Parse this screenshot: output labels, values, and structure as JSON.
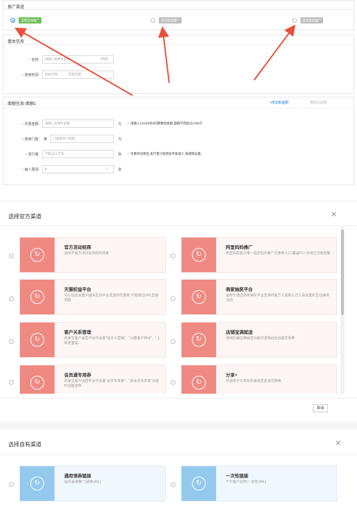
{
  "channel": {
    "section_title": "推广渠道",
    "options": [
      {
        "label": "全网自动推广",
        "checked": true
      },
      {
        "label": "官方渠道推广",
        "checked": false
      },
      {
        "label": "自有渠道推广",
        "checked": false
      }
    ]
  },
  "basic": {
    "section_title": "基本信息",
    "name_label": "名称:",
    "name_placeholder": "请输入优惠券名称",
    "name_counter": "0/10",
    "time_label": "使用时间:",
    "start_placeholder": "起始日期",
    "date_sep": "-",
    "end_placeholder": "结束日期"
  },
  "tier": {
    "section_title": "面额信息-面额1",
    "add_link": "+增加新面额",
    "delete_link": "删除此面额",
    "amount_label": "优惠金额:",
    "amount_placeholder": "请输入优惠券金额",
    "amount_unit": "元",
    "amount_warning": "请输入1/2/3/5及5的整数倍金额,面额不得超过1000元",
    "threshold_label": "使用门槛:",
    "threshold_prefix": "满",
    "threshold_placeholder": "门槛需高于金额",
    "threshold_unit": "元",
    "issue_label": "发行量:",
    "issue_placeholder": "不超过10万张",
    "issue_unit": "张",
    "issue_warning": "优惠券创建后,发行量只能增加不能减少,请谨慎设置。",
    "limit_label": "每人限领:",
    "limit_value": "1",
    "limit_unit": "张"
  },
  "official_dialog": {
    "title": "选择官方渠道",
    "cancel": "取消",
    "cards": [
      {
        "title": "官方活动招商",
        "desc": "适用于官方活动会场招商场景"
      },
      {
        "title": "阿里妈妈推广",
        "desc": "阿里妈妈官方唯一指定站外推广优惠券入口,覆盖PC+无线亿万级流量"
      },
      {
        "title": "天猫权益平台",
        "desc": "可以在此设置只能由互动平台发放的优惠券,不能通过URL直接领取"
      },
      {
        "title": "商家抽奖平台",
        "desc": "适用于通过商家抽奖平台支持的官方工具和三方工具设置的互动抽奖活动"
      },
      {
        "title": "客户关系管理",
        "desc": "商家在客户运营平台中设置\"自定义营销\"、\"兴趣客户转化\"、\"上新老客提..."
      },
      {
        "title": "店铺宝满就送",
        "desc": "使用店铺宝满就送功能可选择此处创建优惠券"
      },
      {
        "title": "会员通专用券",
        "desc": "商家在客户运营平台中设置\"会员专享券\"、\"新会员专享券\"功能时创建该券"
      },
      {
        "title": "分享+",
        "desc": "仅适用于分享有奖渠道发放该优惠券"
      }
    ]
  },
  "own_dialog": {
    "title": "选择自有渠道",
    "cards": [
      {
        "title": "通用领券链接",
        "desc": "站外渠道推广(通用URL)"
      },
      {
        "title": "一次性链接",
        "desc": "千牛客户关怀(一次性URL)"
      }
    ]
  },
  "icons": {
    "card_icon": "refresh-coupon-icon",
    "close": "close-icon",
    "dropdown": "chevron-down-icon",
    "warning": "warning-icon",
    "annotation_arrow": "red-arrow"
  },
  "colors": {
    "accent_blue": "#1e88e5",
    "tag_green": "#6cc15b",
    "official_card_icon": "#ef8a82",
    "own_card_icon": "#94c9ee",
    "arrow_red": "#e8503a",
    "warning_orange": "#f5a623"
  }
}
